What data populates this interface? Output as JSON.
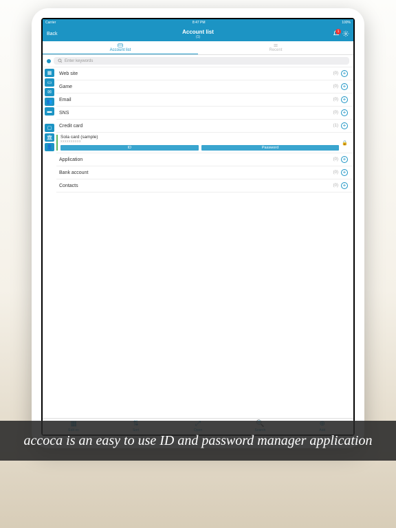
{
  "status": {
    "carrier": "Carrier",
    "time": "8:47 PM",
    "battery": "100%"
  },
  "nav": {
    "back": "Back",
    "title": "Account list",
    "subtitle": "(1)",
    "badge": "1"
  },
  "tabs": {
    "list": "Account list",
    "recent": "Recent"
  },
  "search": {
    "placeholder": "Enter keywords"
  },
  "categories": [
    {
      "name": "Web site",
      "count": "(0)"
    },
    {
      "name": "Game",
      "count": "(0)"
    },
    {
      "name": "Email",
      "count": "(0)"
    },
    {
      "name": "SNS",
      "count": "(0)"
    },
    {
      "name": "Credit card",
      "count": "(1)"
    }
  ],
  "expanded": {
    "name": "Sola card (sample)",
    "masked": "xxxxxxxxxx",
    "id_btn": "ID",
    "pw_btn": "Password"
  },
  "categories2": [
    {
      "name": "Application",
      "count": "(0)"
    },
    {
      "name": "Bank account",
      "count": "(0)"
    },
    {
      "name": "Contacts",
      "count": "(0)"
    }
  ],
  "toolbar": {
    "edit": "Edit on",
    "sort": "Sort",
    "open": "Open",
    "search": "Search",
    "add": "Add"
  },
  "caption": "accoca is an easy to use ID and password manager application"
}
